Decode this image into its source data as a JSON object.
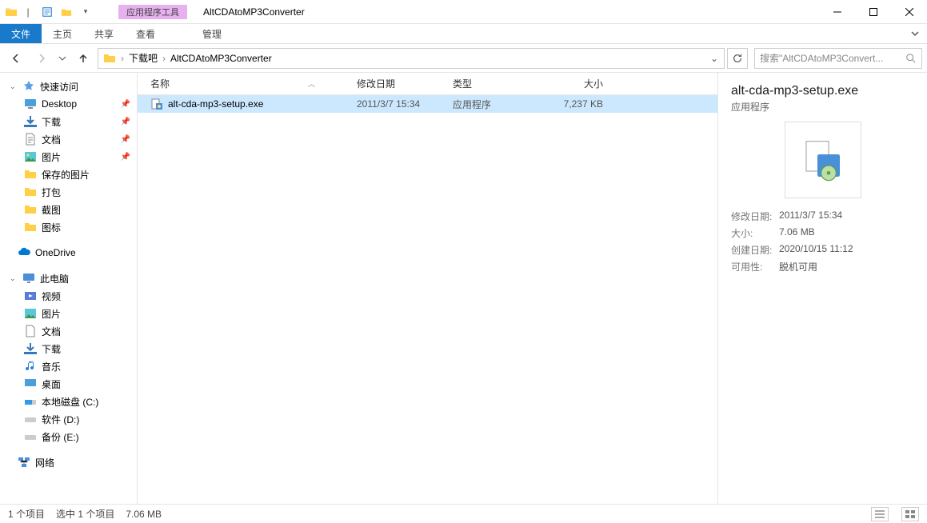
{
  "title": {
    "app_tools": "应用程序工具",
    "window": "AltCDAtoMP3Converter"
  },
  "ribbon": {
    "file": "文件",
    "home": "主页",
    "share": "共享",
    "view": "查看",
    "manage": "管理"
  },
  "address": {
    "crumbs": [
      "下载吧",
      "AltCDAtoMP3Converter"
    ]
  },
  "search": {
    "placeholder": "搜索\"AltCDAtoMP3Convert..."
  },
  "sidebar": {
    "quick": {
      "label": "快速访问",
      "items": [
        {
          "label": "Desktop",
          "pinned": true
        },
        {
          "label": "下载",
          "pinned": true
        },
        {
          "label": "文档",
          "pinned": true
        },
        {
          "label": "图片",
          "pinned": true
        },
        {
          "label": "保存的图片"
        },
        {
          "label": "打包"
        },
        {
          "label": "截图"
        },
        {
          "label": "图标"
        }
      ]
    },
    "onedrive": "OneDrive",
    "thispc": {
      "label": "此电脑",
      "items": [
        {
          "label": "视频"
        },
        {
          "label": "图片"
        },
        {
          "label": "文档"
        },
        {
          "label": "下载"
        },
        {
          "label": "音乐"
        },
        {
          "label": "桌面"
        },
        {
          "label": "本地磁盘 (C:)"
        },
        {
          "label": "软件 (D:)"
        },
        {
          "label": "备份 (E:)"
        }
      ]
    },
    "network": "网络"
  },
  "columns": {
    "name": "名称",
    "date": "修改日期",
    "type": "类型",
    "size": "大小"
  },
  "files": [
    {
      "name": "alt-cda-mp3-setup.exe",
      "date": "2011/3/7 15:34",
      "type": "应用程序",
      "size": "7,237 KB"
    }
  ],
  "details": {
    "name": "alt-cda-mp3-setup.exe",
    "type": "应用程序",
    "props": {
      "date_k": "修改日期:",
      "date_v": "2011/3/7 15:34",
      "size_k": "大小:",
      "size_v": "7.06 MB",
      "created_k": "创建日期:",
      "created_v": "2020/10/15 11:12",
      "avail_k": "可用性:",
      "avail_v": "脱机可用"
    }
  },
  "status": {
    "items": "1 个项目",
    "selected": "选中 1 个项目",
    "size": "7.06 MB"
  }
}
